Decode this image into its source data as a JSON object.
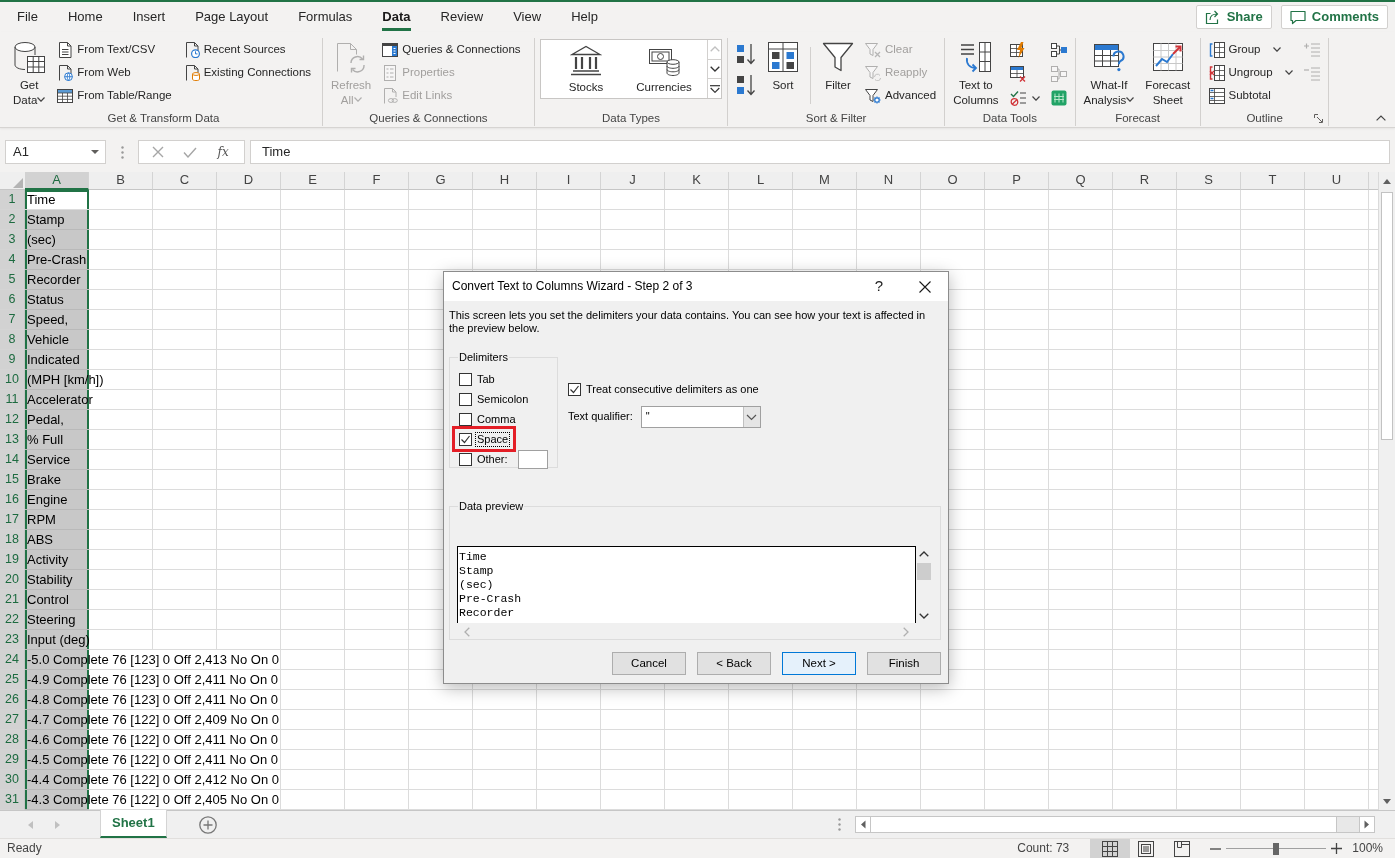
{
  "ribbon_tabs": [
    {
      "label": "File",
      "selected": false
    },
    {
      "label": "Home",
      "selected": false
    },
    {
      "label": "Insert",
      "selected": false
    },
    {
      "label": "Page Layout",
      "selected": false
    },
    {
      "label": "Formulas",
      "selected": false
    },
    {
      "label": "Data",
      "selected": true
    },
    {
      "label": "Review",
      "selected": false
    },
    {
      "label": "View",
      "selected": false
    },
    {
      "label": "Help",
      "selected": false
    }
  ],
  "header_buttons": [
    {
      "label": "Share"
    },
    {
      "label": "Comments"
    }
  ],
  "ribbon_groups": [
    {
      "label": "Get & Transform Data",
      "launcher": false,
      "buttons": [
        {
          "kind": "large",
          "label": "Get Data",
          "dropdown": true,
          "disabled": false
        },
        {
          "kind": "small",
          "label": "From Text/CSV",
          "dropdown": false,
          "disabled": false
        },
        {
          "kind": "small",
          "label": "From Web",
          "dropdown": false,
          "disabled": false
        },
        {
          "kind": "small",
          "label": "From Table/Range",
          "dropdown": false,
          "disabled": false
        },
        {
          "kind": "small",
          "label": "Recent Sources",
          "dropdown": false,
          "disabled": false
        },
        {
          "kind": "small",
          "label": "Existing Connections",
          "dropdown": false,
          "disabled": false
        }
      ]
    },
    {
      "label": "Queries & Connections",
      "launcher": false,
      "buttons": [
        {
          "kind": "large",
          "label": "Refresh All",
          "dropdown": true,
          "disabled": true
        },
        {
          "kind": "small",
          "label": "Queries & Connections",
          "dropdown": false,
          "disabled": false
        },
        {
          "kind": "small",
          "label": "Properties",
          "dropdown": false,
          "disabled": true
        },
        {
          "kind": "small",
          "label": "Edit Links",
          "dropdown": false,
          "disabled": true
        }
      ]
    },
    {
      "label": "Data Types",
      "launcher": false,
      "buttons": [
        {
          "kind": "gallery",
          "items": [
            {
              "label": "Stocks"
            },
            {
              "label": "Currencies"
            }
          ]
        }
      ]
    },
    {
      "label": "Sort & Filter",
      "launcher": false,
      "buttons": [
        {
          "kind": "icon",
          "dropdown": false,
          "disabled": false
        },
        {
          "kind": "icon",
          "dropdown": false,
          "disabled": false
        },
        {
          "kind": "large",
          "label": "Sort",
          "dropdown": false,
          "disabled": false
        },
        {
          "kind": "separator"
        },
        {
          "kind": "large",
          "label": "Filter",
          "dropdown": false,
          "disabled": false
        },
        {
          "kind": "small",
          "label": "Clear",
          "dropdown": false,
          "disabled": true
        },
        {
          "kind": "small",
          "label": "Reapply",
          "dropdown": false,
          "disabled": true
        },
        {
          "kind": "small",
          "label": "Advanced",
          "dropdown": false,
          "disabled": false
        }
      ]
    },
    {
      "label": "Data Tools",
      "launcher": false,
      "buttons": [
        {
          "kind": "large",
          "label": "Text to Columns",
          "dropdown": false,
          "disabled": false
        },
        {
          "kind": "icon",
          "dropdown": false,
          "disabled": false
        },
        {
          "kind": "icon",
          "dropdown": false,
          "disabled": false
        },
        {
          "kind": "icon",
          "dropdown": true,
          "disabled": false
        },
        {
          "kind": "icon",
          "dropdown": false,
          "disabled": false
        },
        {
          "kind": "icon",
          "dropdown": false,
          "disabled": true
        },
        {
          "kind": "icon",
          "dropdown": false,
          "disabled": false
        }
      ]
    },
    {
      "label": "Forecast",
      "launcher": false,
      "buttons": [
        {
          "kind": "large",
          "label": "What-If Analysis",
          "dropdown": true,
          "disabled": false
        },
        {
          "kind": "large",
          "label": "Forecast Sheet",
          "dropdown": false,
          "disabled": false
        }
      ]
    },
    {
      "label": "Outline",
      "launcher": true,
      "buttons": [
        {
          "kind": "small",
          "label": "Group",
          "dropdown": true,
          "disabled": false
        },
        {
          "kind": "small",
          "label": "Ungroup",
          "dropdown": true,
          "disabled": false
        },
        {
          "kind": "small",
          "label": "Subtotal",
          "dropdown": false,
          "disabled": false
        },
        {
          "kind": "icon",
          "dropdown": false,
          "disabled": true
        },
        {
          "kind": "icon",
          "dropdown": false,
          "disabled": true
        }
      ]
    }
  ],
  "formula_bar": {
    "name_box": "A1",
    "function_label": "fx",
    "value": "Time"
  },
  "sheet": {
    "columns": [
      {
        "label": "A",
        "selected": true
      },
      {
        "label": "B",
        "selected": false
      },
      {
        "label": "C",
        "selected": false
      },
      {
        "label": "D",
        "selected": false
      },
      {
        "label": "E",
        "selected": false
      },
      {
        "label": "F",
        "selected": false
      },
      {
        "label": "G",
        "selected": false
      },
      {
        "label": "H",
        "selected": false
      },
      {
        "label": "I",
        "selected": false
      },
      {
        "label": "J",
        "selected": false
      },
      {
        "label": "K",
        "selected": false
      },
      {
        "label": "L",
        "selected": false
      },
      {
        "label": "M",
        "selected": false
      },
      {
        "label": "N",
        "selected": false
      },
      {
        "label": "O",
        "selected": false
      },
      {
        "label": "P",
        "selected": false
      },
      {
        "label": "Q",
        "selected": false
      },
      {
        "label": "R",
        "selected": false
      },
      {
        "label": "S",
        "selected": false
      },
      {
        "label": "T",
        "selected": false
      },
      {
        "label": "U",
        "selected": false
      }
    ],
    "rows": [
      {
        "header": "1",
        "selected": true,
        "active": true,
        "cells": [
          "Time"
        ]
      },
      {
        "header": "2",
        "selected": true,
        "active": false,
        "cells": [
          "Stamp"
        ]
      },
      {
        "header": "3",
        "selected": true,
        "active": false,
        "cells": [
          "(sec)"
        ]
      },
      {
        "header": "4",
        "selected": true,
        "active": false,
        "cells": [
          "Pre-Crash"
        ]
      },
      {
        "header": "5",
        "selected": true,
        "active": false,
        "cells": [
          "Recorder"
        ]
      },
      {
        "header": "6",
        "selected": true,
        "active": false,
        "cells": [
          "Status"
        ]
      },
      {
        "header": "7",
        "selected": true,
        "active": false,
        "cells": [
          "Speed,"
        ]
      },
      {
        "header": "8",
        "selected": true,
        "active": false,
        "cells": [
          "Vehicle"
        ]
      },
      {
        "header": "9",
        "selected": true,
        "active": false,
        "cells": [
          "Indicated"
        ]
      },
      {
        "header": "10",
        "selected": true,
        "active": false,
        "cells": [
          "(MPH [km/h])"
        ]
      },
      {
        "header": "11",
        "selected": true,
        "active": false,
        "cells": [
          "Accelerator"
        ]
      },
      {
        "header": "12",
        "selected": true,
        "active": false,
        "cells": [
          "Pedal,"
        ]
      },
      {
        "header": "13",
        "selected": true,
        "active": false,
        "cells": [
          "% Full"
        ]
      },
      {
        "header": "14",
        "selected": true,
        "active": false,
        "cells": [
          "Service"
        ]
      },
      {
        "header": "15",
        "selected": true,
        "active": false,
        "cells": [
          "Brake"
        ]
      },
      {
        "header": "16",
        "selected": true,
        "active": false,
        "cells": [
          "Engine"
        ]
      },
      {
        "header": "17",
        "selected": true,
        "active": false,
        "cells": [
          "RPM"
        ]
      },
      {
        "header": "18",
        "selected": true,
        "active": false,
        "cells": [
          "ABS"
        ]
      },
      {
        "header": "19",
        "selected": true,
        "active": false,
        "cells": [
          "Activity"
        ]
      },
      {
        "header": "20",
        "selected": true,
        "active": false,
        "cells": [
          "Stability"
        ]
      },
      {
        "header": "21",
        "selected": true,
        "active": false,
        "cells": [
          "Control"
        ]
      },
      {
        "header": "22",
        "selected": true,
        "active": false,
        "cells": [
          "Steering"
        ]
      },
      {
        "header": "23",
        "selected": true,
        "active": false,
        "cells": [
          "Input (deg)"
        ]
      },
      {
        "header": "24",
        "selected": true,
        "active": false,
        "cells": [
          "-5.0 Complete 76 [123] 0 Off 2,413 No On 0"
        ]
      },
      {
        "header": "25",
        "selected": true,
        "active": false,
        "cells": [
          "-4.9 Complete 76 [123] 0 Off 2,411 No On 0"
        ]
      },
      {
        "header": "26",
        "selected": true,
        "active": false,
        "cells": [
          "-4.8 Complete 76 [123] 0 Off 2,411 No On 0"
        ]
      },
      {
        "header": "27",
        "selected": true,
        "active": false,
        "cells": [
          "-4.7 Complete 76 [122] 0 Off 2,409 No On 0"
        ]
      },
      {
        "header": "28",
        "selected": true,
        "active": false,
        "cells": [
          "-4.6 Complete 76 [122] 0 Off 2,411 No On 0"
        ]
      },
      {
        "header": "29",
        "selected": true,
        "active": false,
        "cells": [
          "-4.5 Complete 76 [122] 0 Off 2,411 No On 0"
        ]
      },
      {
        "header": "30",
        "selected": true,
        "active": false,
        "cells": [
          "-4.4 Complete 76 [122] 0 Off 2,412 No On 0"
        ]
      },
      {
        "header": "31",
        "selected": true,
        "active": false,
        "cells": [
          "-4.3 Complete 76 [122] 0 Off 2,405 No On 0"
        ]
      }
    ]
  },
  "sheet_tabs": [
    {
      "label": "Sheet1",
      "selected": true
    }
  ],
  "status_bar": {
    "mode": "Ready",
    "summary": "Count: 73",
    "view_buttons": [
      {
        "selected": true
      },
      {
        "selected": false
      },
      {
        "selected": false
      }
    ],
    "zoom": {
      "level": 0.5,
      "reading": "100%"
    }
  },
  "dialog": {
    "title": "Convert Text to Columns Wizard - Step 2 of 3",
    "help": "?",
    "instructions": "This screen lets you set the delimiters your data contains. You can see how your text is affected in the preview below.",
    "delimiters_label": "Delimiters",
    "delimiters": [
      {
        "kind": "checkbox",
        "label": "Tab",
        "checked": false,
        "highlighted": false,
        "focused": false
      },
      {
        "kind": "checkbox",
        "label": "Semicolon",
        "checked": false,
        "highlighted": false,
        "focused": false
      },
      {
        "kind": "checkbox",
        "label": "Comma",
        "checked": false,
        "highlighted": false,
        "focused": false
      },
      {
        "kind": "checkbox",
        "label": "Space",
        "checked": true,
        "highlighted": true,
        "focused": true
      },
      {
        "kind": "checkbox_field",
        "label": "Other:",
        "checked": false,
        "highlighted": false,
        "focused": false
      }
    ],
    "consecutive": {
      "label": "Treat consecutive delimiters as one",
      "checked": true
    },
    "text_qualifier": {
      "label": "Text qualifier:",
      "value": "\""
    },
    "preview": {
      "label": "Data preview",
      "lines": [
        "Time",
        "Stamp",
        "(sec)",
        "Pre-Crash",
        "Recorder"
      ]
    },
    "buttons": [
      {
        "label": "Cancel",
        "default": false
      },
      {
        "label": "< Back",
        "default": false
      },
      {
        "label": "Next >",
        "default": true
      },
      {
        "label": "Finish",
        "default": false
      }
    ]
  }
}
